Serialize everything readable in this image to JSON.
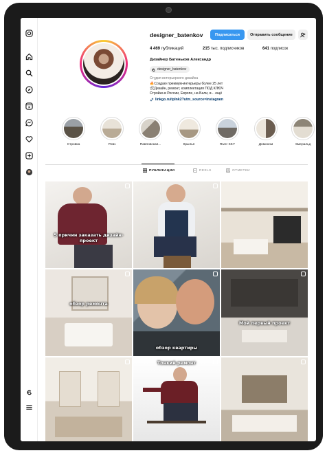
{
  "profile": {
    "username": "designer_batenkov",
    "follow_label": "Подписаться",
    "message_label": "Отправить сообщение",
    "posts_count": "4 469",
    "posts_label": "публикаций",
    "followers_count": "215",
    "followers_label": "тыс. подписчиков",
    "following_count": "641",
    "following_label": "подписок",
    "full_name": "Дизайнер Батеньков Александр",
    "threads_handle": "designer_batenkov",
    "category": "Студия интерьерного дизайна",
    "bio_lines": [
      "🔥Создаю премиум-интерьеры более 25 лет",
      "🛠Дизайн, ремонт, комплектация ПОД КЛЮЧ",
      "Стройка в России, Европе, на Бали, в... ещё"
    ],
    "link": "linkgo.ru/tplnk2?utm_source=instagram"
  },
  "highlights": [
    {
      "label": "Стройка"
    },
    {
      "label": "Ривз"
    },
    {
      "label": "Павловская..."
    },
    {
      "label": "Крылья"
    },
    {
      "label": "River SKY"
    },
    {
      "label": "Домоном"
    },
    {
      "label": "Эмеральд"
    }
  ],
  "tabs": [
    {
      "label": "ПУБЛИКАЦИИ",
      "active": true
    },
    {
      "label": "REELS",
      "active": false
    },
    {
      "label": "ОТМЕТКИ",
      "active": false
    }
  ],
  "posts": [
    {
      "caption": "5 причин заказать дизайн-проект"
    },
    {
      "caption": ""
    },
    {
      "caption": ""
    },
    {
      "caption": "обзор ремонта"
    },
    {
      "caption": "обзор квартиры"
    },
    {
      "caption": "Мой первый проект"
    },
    {
      "caption": ""
    },
    {
      "caption": "Тонкий ремонт"
    },
    {
      "caption": ""
    }
  ],
  "colors": {
    "accent": "#3897f0",
    "link": "#00376b",
    "frame": "#1b1b1b"
  }
}
